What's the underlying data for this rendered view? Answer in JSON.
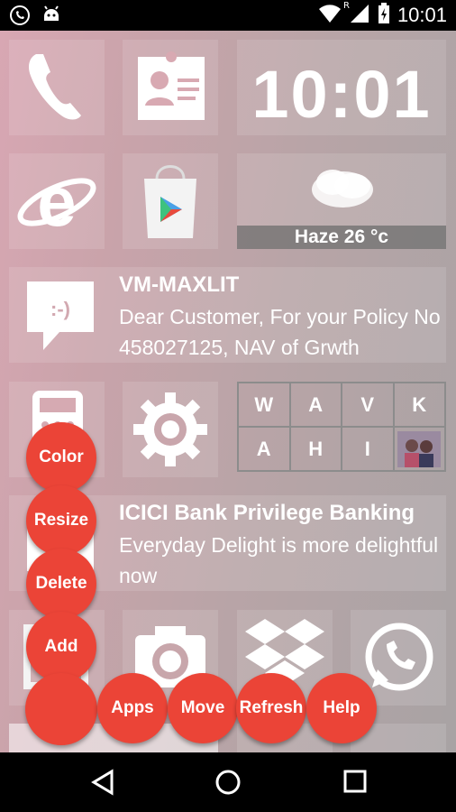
{
  "status": {
    "time": "10:01",
    "signal_badge": "R"
  },
  "tiles": {
    "clock": "10:01",
    "weather": "Haze 26 °c",
    "message1": {
      "title": "VM-MAXLIT",
      "body": "Dear Customer, For your Policy No 458027125, NAV of Grwth"
    },
    "message2": {
      "title": "ICICI Bank Privilege Banking",
      "body": "Everyday Delight is more delightful now"
    },
    "letters": [
      "W",
      "A",
      "V",
      "K",
      "A",
      "H",
      "I"
    ]
  },
  "fab_menu": {
    "color": "Color",
    "resize": "Resize",
    "delete": "Delete",
    "add": "Add",
    "apps": "Apps",
    "move": "Move",
    "refresh": "Refresh",
    "help": "Help"
  },
  "colors": {
    "fab": "#eb4437",
    "status_bar": "#000000"
  }
}
